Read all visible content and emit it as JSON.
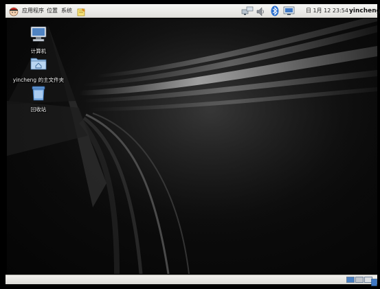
{
  "top_panel": {
    "menus": {
      "applications": "应用程序",
      "places": "位置",
      "system": "系统"
    },
    "clock": "日 1月 12 23:54",
    "user": "yincheng",
    "icons": [
      "redhat-logo-icon",
      "notes-icon",
      "network-icon",
      "volume-icon",
      "bluetooth-icon",
      "update-icon"
    ]
  },
  "desktop": {
    "icons": [
      {
        "label": "计算机",
        "icon": "computer-icon"
      },
      {
        "label": "yincheng 的主文件夹",
        "icon": "home-folder-icon"
      },
      {
        "label": "回收站",
        "icon": "trash-icon"
      }
    ]
  },
  "bottom_panel": {
    "workspaces": [
      "workspace-1",
      "workspace-2",
      "workspace-3",
      "workspace-4"
    ]
  },
  "colors": {
    "panel": "#e6e5e1",
    "desktop": "#0a0a0a",
    "accent": "#3c78d8"
  }
}
